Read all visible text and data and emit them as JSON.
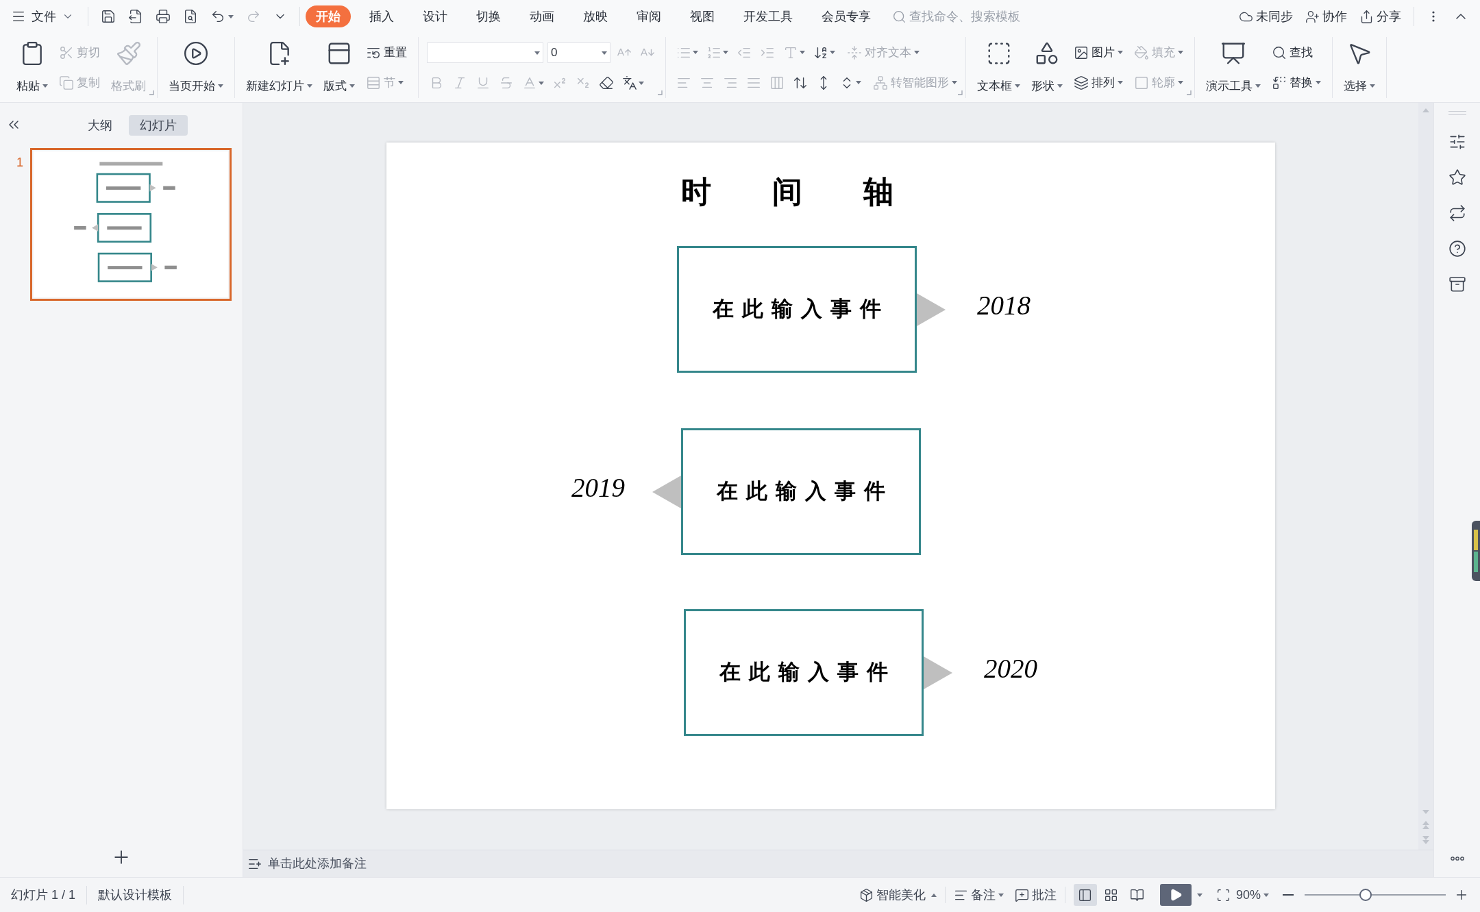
{
  "menu": {
    "file": "文件",
    "tabs": [
      {
        "label": "开始",
        "selected": true
      },
      {
        "label": "插入",
        "selected": false
      },
      {
        "label": "设计",
        "selected": false
      },
      {
        "label": "切换",
        "selected": false
      },
      {
        "label": "动画",
        "selected": false
      },
      {
        "label": "放映",
        "selected": false
      },
      {
        "label": "审阅",
        "selected": false
      },
      {
        "label": "视图",
        "selected": false
      },
      {
        "label": "开发工具",
        "selected": false
      },
      {
        "label": "会员专享",
        "selected": false
      }
    ],
    "search": {
      "placeholder": "查找命令、搜索模板"
    },
    "actions": [
      "未同步",
      "协作",
      "分享"
    ]
  },
  "ribbon": {
    "groups": [
      {
        "launcher": true,
        "items": [
          {
            "kind": "large",
            "label": "粘贴",
            "dropdown": true,
            "disabled": false
          },
          {
            "kind": "stack",
            "buttons": [
              {
                "label": "剪切",
                "dropdown": false,
                "disabled": true
              },
              {
                "label": "复制",
                "dropdown": false,
                "disabled": true
              }
            ]
          },
          {
            "kind": "large",
            "label": "格式刷",
            "dropdown": false,
            "disabled": true
          }
        ]
      },
      {
        "items": [
          {
            "kind": "large",
            "label": "当页开始",
            "dropdown": true,
            "disabled": false
          }
        ]
      },
      {
        "items": [
          {
            "kind": "large",
            "label": "新建幻灯片",
            "dropdown": true,
            "disabled": false
          },
          {
            "kind": "large",
            "label": "版式",
            "dropdown": true,
            "disabled": false
          },
          {
            "kind": "stack",
            "buttons": [
              {
                "label": "重置",
                "dropdown": false,
                "disabled": false
              },
              {
                "label": "节",
                "dropdown": true,
                "disabled": true
              }
            ]
          }
        ]
      },
      {
        "launcher": true,
        "items": [
          {
            "kind": "rows",
            "rows": [
              [
                {
                  "kind": "field",
                  "dropdown": true
                },
                {
                  "kind": "field",
                  "value": "0",
                  "dropdown": true
                },
                {
                  "kind": "icon",
                  "disabled": true,
                  "dropdown": false
                },
                {
                  "kind": "icon",
                  "disabled": true,
                  "dropdown": false
                }
              ],
              [
                {
                  "kind": "icon",
                  "disabled": true,
                  "dropdown": false
                },
                {
                  "kind": "icon",
                  "disabled": true,
                  "dropdown": false
                },
                {
                  "kind": "icon",
                  "disabled": true,
                  "dropdown": false
                },
                {
                  "kind": "icon",
                  "disabled": true,
                  "dropdown": false
                },
                {
                  "kind": "icon",
                  "disabled": true,
                  "dropdown": true
                },
                {
                  "kind": "icon",
                  "disabled": true,
                  "dropdown": false
                },
                {
                  "kind": "icon",
                  "disabled": true,
                  "dropdown": false
                },
                {
                  "kind": "icon",
                  "disabled": false,
                  "dropdown": false
                },
                {
                  "kind": "icon",
                  "disabled": false,
                  "dropdown": true
                }
              ]
            ]
          }
        ]
      },
      {
        "launcher": true,
        "items": [
          {
            "kind": "rows",
            "rows": [
              [
                {
                  "kind": "icon",
                  "disabled": true,
                  "dropdown": true
                },
                {
                  "kind": "icon",
                  "disabled": true,
                  "dropdown": true
                },
                {
                  "kind": "icon",
                  "disabled": true,
                  "dropdown": false
                },
                {
                  "kind": "icon",
                  "disabled": true,
                  "dropdown": false
                },
                {
                  "kind": "icon",
                  "disabled": true,
                  "dropdown": true
                },
                {
                  "kind": "icon",
                  "disabled": false,
                  "dropdown": true
                },
                {
                  "kind": "button",
                  "label": "对齐文本",
                  "disabled": true,
                  "dropdown": true
                }
              ],
              [
                {
                  "kind": "icon",
                  "disabled": true,
                  "dropdown": false
                },
                {
                  "kind": "icon",
                  "disabled": true,
                  "dropdown": false
                },
                {
                  "kind": "icon",
                  "disabled": true,
                  "dropdown": false
                },
                {
                  "kind": "icon",
                  "disabled": true,
                  "dropdown": false
                },
                {
                  "kind": "icon",
                  "disabled": true,
                  "dropdown": false
                },
                {
                  "kind": "icon",
                  "disabled": false,
                  "dropdown": false
                },
                {
                  "kind": "icon",
                  "disabled": false,
                  "dropdown": false
                },
                {
                  "kind": "icon",
                  "disabled": false,
                  "dropdown": true
                },
                {
                  "kind": "button",
                  "label": "转智能图形",
                  "disabled": true,
                  "dropdown": true
                }
              ]
            ]
          }
        ]
      },
      {
        "launcher": true,
        "items": [
          {
            "kind": "large",
            "label": "文本框",
            "dropdown": true,
            "disabled": false
          },
          {
            "kind": "large",
            "label": "形状",
            "dropdown": true,
            "disabled": false
          },
          {
            "kind": "stack",
            "buttons": [
              {
                "label": "图片",
                "dropdown": true,
                "disabled": false
              },
              {
                "label": "排列",
                "dropdown": true,
                "disabled": false
              }
            ]
          },
          {
            "kind": "stack",
            "buttons": [
              {
                "label": "填充",
                "dropdown": true,
                "disabled": true
              },
              {
                "label": "轮廓",
                "dropdown": true,
                "disabled": true
              }
            ]
          }
        ]
      },
      {
        "items": [
          {
            "kind": "large",
            "label": "演示工具",
            "dropdown": true,
            "disabled": false
          },
          {
            "kind": "stack",
            "buttons": [
              {
                "label": "查找",
                "dropdown": false,
                "disabled": false
              },
              {
                "label": "替换",
                "dropdown": true,
                "disabled": false
              }
            ]
          }
        ]
      },
      {
        "items": [
          {
            "kind": "large",
            "label": "选择",
            "dropdown": true,
            "disabled": false
          }
        ]
      }
    ]
  },
  "left_panel": {
    "tabs": [
      {
        "label": "大纲",
        "selected": false
      },
      {
        "label": "幻灯片",
        "selected": true
      }
    ],
    "slides": [
      {
        "number": "1",
        "selected": true
      }
    ]
  },
  "slide": {
    "title": "时间轴",
    "events": [
      {
        "text": "在此输入事件",
        "year": "2018",
        "kind": "right"
      },
      {
        "text": "在此输入事件",
        "year": "2019",
        "kind": "left"
      },
      {
        "text": "在此输入事件",
        "year": "2020",
        "kind": "right"
      }
    ]
  },
  "notes": {
    "placeholder": "单击此处添加备注"
  },
  "status_bar": {
    "left": [
      "幻灯片 1 / 1",
      "默认设计模板"
    ],
    "beautify": "智能美化",
    "notes": "备注",
    "comments": "批注",
    "views": [
      {
        "selected": true
      },
      {
        "selected": false
      },
      {
        "selected": false
      }
    ],
    "zoom": "90%",
    "zoom_slider": {
      "level": 0.43
    }
  }
}
